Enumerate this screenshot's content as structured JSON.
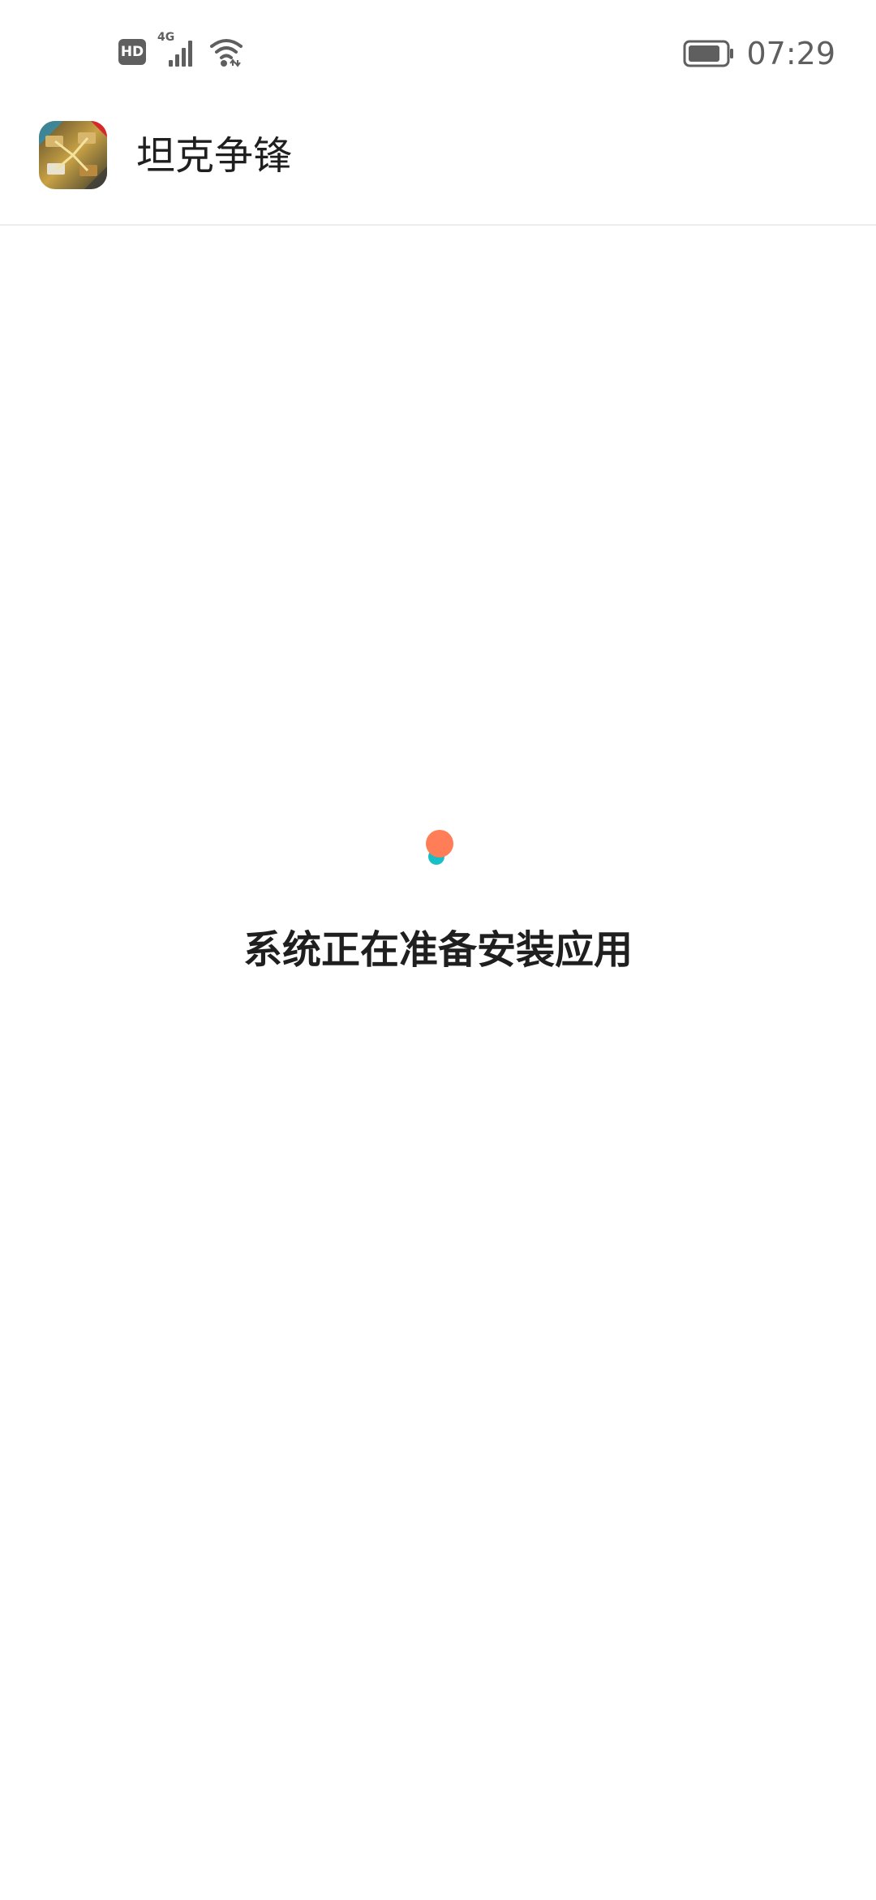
{
  "status_bar": {
    "hd_badge": "HD",
    "network_type": "4G",
    "time": "07:29",
    "icons": [
      "hd-icon",
      "cell-signal-icon",
      "wifi-icon",
      "battery-icon"
    ]
  },
  "app": {
    "title": "坦克争锋",
    "icon": "tank-game-icon"
  },
  "main": {
    "status_message": "系统正在准备安装应用",
    "loader": {
      "icon": "loading-dots-icon",
      "colors": [
        "#ff7e57",
        "#19bfc6"
      ]
    }
  },
  "colors": {
    "background": "#ffffff",
    "text_primary": "#1f1f1f",
    "status_gray": "#5f5f5f",
    "divider": "#ececec"
  }
}
